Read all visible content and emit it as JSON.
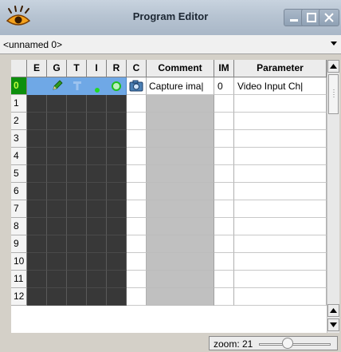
{
  "window": {
    "title": "Program Editor",
    "icon": "eye-icon"
  },
  "program_select": {
    "value": "<unnamed 0>"
  },
  "grid": {
    "columns": [
      "",
      "E",
      "G",
      "T",
      "I",
      "R",
      "C",
      "Comment",
      "IM",
      "Parameter"
    ],
    "rows": [
      "0",
      "1",
      "2",
      "3",
      "4",
      "5",
      "6",
      "7",
      "8",
      "9",
      "10",
      "11",
      "12"
    ],
    "selected_row": "0",
    "row0": {
      "G_icon": "pencil-icon",
      "T_icon": "text-icon",
      "I_icon": "green-dot-icon",
      "R_icon": "green-ring-icon",
      "C_icon": "camera-icon",
      "comment": "Capture ima|",
      "im": "0",
      "parameter": "Video Input Ch|"
    }
  },
  "status": {
    "zoom_label": "zoom: 21"
  },
  "colors": {
    "selected_row_bg": "#0d8f0d",
    "selected_row_text": "#bfff3a",
    "selected_cells": "#6fa8e6",
    "dark_cells": "#383838"
  }
}
